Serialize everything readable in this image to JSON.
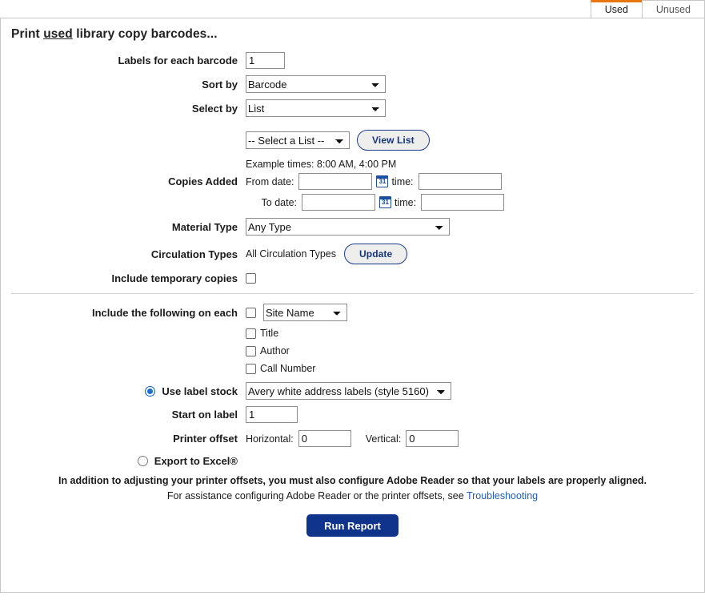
{
  "tabs": [
    {
      "label": "Used",
      "active": true
    },
    {
      "label": "Unused",
      "active": false
    }
  ],
  "page_title": {
    "prefix": "Print ",
    "emphasis": "used",
    "suffix": " library copy barcodes..."
  },
  "form": {
    "labels_for_each_barcode": {
      "label": "Labels for each barcode",
      "value": "1"
    },
    "sort_by": {
      "label": "Sort by",
      "value": "Barcode",
      "options": [
        "Barcode"
      ]
    },
    "select_by": {
      "label": "Select by",
      "value": "List",
      "options": [
        "List"
      ]
    },
    "list_picker": {
      "value": "-- Select a List --",
      "options": [
        "-- Select a List --"
      ],
      "button_label": "View List"
    },
    "example_times": "Example times: 8:00 AM, 4:00 PM",
    "copies_added": {
      "label": "Copies Added",
      "from_date_label": "From date:",
      "from_date_value": "",
      "from_time_label": "time:",
      "from_time_value": "",
      "to_date_label": "To date:",
      "to_date_value": "",
      "to_time_label": "time:",
      "to_time_value": "",
      "calendar_icon_text": "31"
    },
    "material_type": {
      "label": "Material Type",
      "value": "Any Type",
      "options": [
        "Any Type"
      ]
    },
    "circulation_types": {
      "label": "Circulation Types",
      "value": "All Circulation Types",
      "button_label": "Update"
    },
    "include_temporary_copies": {
      "label": "Include temporary copies",
      "checked": false
    },
    "include_on_each": {
      "label": "Include the following on each",
      "site_name": {
        "checked": false,
        "value": "Site Name",
        "options": [
          "Site Name"
        ]
      },
      "items": [
        {
          "label": "Title",
          "checked": false
        },
        {
          "label": "Author",
          "checked": false
        },
        {
          "label": "Call Number",
          "checked": false
        }
      ]
    },
    "output": {
      "use_label_stock": {
        "label": "Use label stock",
        "selected": true,
        "value": "Avery white address labels (style 5160)",
        "options": [
          "Avery white address labels (style 5160)"
        ]
      },
      "start_on_label": {
        "label": "Start on label",
        "value": "1"
      },
      "printer_offset": {
        "label": "Printer offset",
        "horizontal_label": "Horizontal:",
        "horizontal_value": "0",
        "vertical_label": "Vertical:",
        "vertical_value": "0"
      },
      "export_to_excel": {
        "label": "Export to Excel®",
        "selected": false
      }
    }
  },
  "notes": {
    "line1": "In addition to adjusting your printer offsets, you must also configure Adobe Reader so that your labels are properly aligned.",
    "line2_prefix": "For assistance configuring Adobe Reader or the printer offsets, see ",
    "line2_link": "Troubleshooting"
  },
  "run_report_label": "Run Report",
  "colors": {
    "active_tab_accent": "#e8760e",
    "primary_button": "#10338c",
    "outline_button_text": "#16357a",
    "link": "#2060b8",
    "radio_selected": "#1a6fd4",
    "calendar_icon": "#1b4fa0"
  }
}
